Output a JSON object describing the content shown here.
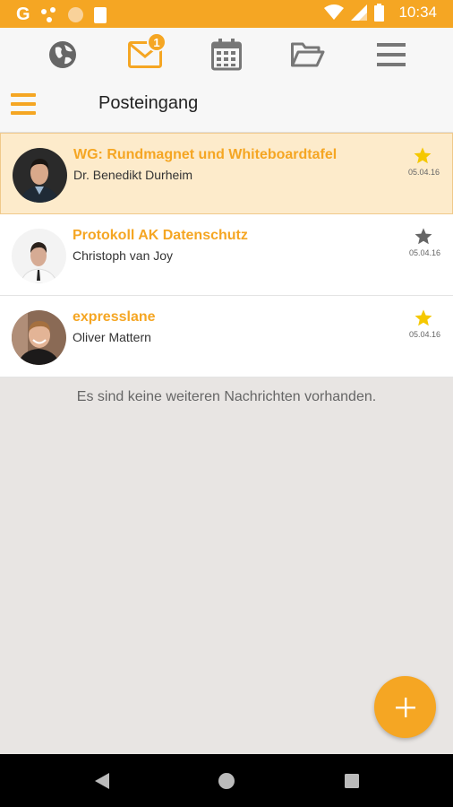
{
  "status_bar": {
    "time": "10:34",
    "g_letter": "G",
    "icons": [
      "google-icon",
      "notification-dots-icon",
      "circle-icon",
      "sim-card-icon",
      "wifi-icon",
      "signal-icon",
      "battery-icon"
    ]
  },
  "tabs": [
    {
      "name": "globe-icon"
    },
    {
      "name": "mail-icon",
      "badge": "1",
      "active": true
    },
    {
      "name": "calendar-icon"
    },
    {
      "name": "folder-icon"
    },
    {
      "name": "list-menu-icon"
    }
  ],
  "header": {
    "title": "Posteingang"
  },
  "messages": [
    {
      "subject": "WG: Rundmagnet und Whiteboardtafel",
      "sender": "Dr. Benedikt Durheim",
      "date": "05.04.16",
      "starred": true,
      "selected": true
    },
    {
      "subject": "Protokoll AK Datenschutz",
      "sender": "Christoph van Joy",
      "date": "05.04.16",
      "starred": false,
      "selected": false
    },
    {
      "subject": "expresslane",
      "sender": "Oliver Mattern",
      "date": "05.04.16",
      "starred": true,
      "selected": false
    }
  ],
  "empty_note": "Es sind keine weiteren Nachrichten vorhanden.",
  "fab": {
    "symbol": "+"
  },
  "colors": {
    "accent": "#f5a623",
    "selected_bg": "#fdebcb",
    "star_active": "#f5c800",
    "star_inactive": "#666666",
    "list_bg": "#e8e5e3"
  }
}
